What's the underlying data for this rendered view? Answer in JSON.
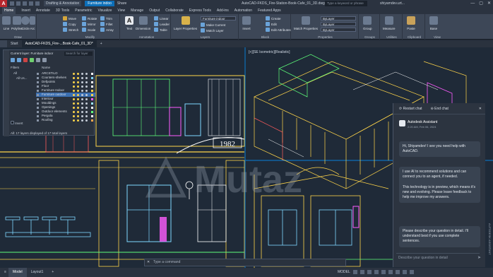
{
  "titlebar": {
    "logo": "A",
    "workspace": "Drafting & Annotation",
    "file_tab": "Furniture indoo",
    "share": "Share",
    "document_title": "AutoCAD-FKDS_Fire-Station-Book-Cafe_01_3D.dwg",
    "search_placeholder": "Type a keyword or phrase",
    "user": "shiyamdev.urt...",
    "min": "—",
    "max": "▢",
    "close": "✕"
  },
  "ribbon_tabs": [
    "Home",
    "Insert",
    "Annotate",
    "3D Tools",
    "Parametric",
    "Visualize",
    "View",
    "Manage",
    "Output",
    "Collaborate",
    "Express Tools",
    "Add-ins",
    "Automation",
    "Featured Apps"
  ],
  "ribbon": {
    "draw": {
      "title": "Draw",
      "buttons": [
        "Line",
        "Polyline",
        "Circle",
        "Arc"
      ]
    },
    "modify": {
      "title": "Modify",
      "buttons": [
        "Move",
        "Copy",
        "Stretch",
        "Rotate",
        "Mirror",
        "Scale",
        "Trim",
        "Fillet",
        "Array"
      ]
    },
    "annotation": {
      "title": "Annotation",
      "buttons": [
        "Text",
        "Dimension",
        "Linear",
        "Leader",
        "Table"
      ]
    },
    "layers": {
      "title": "Layers",
      "big": "Layer Properties",
      "current_layer": "Furniture indoor",
      "buttons": [
        "Make Current",
        "Match Layer"
      ]
    },
    "block": {
      "title": "Block",
      "buttons": [
        "Insert",
        "Create",
        "Edit",
        "Edit Attributes"
      ]
    },
    "properties": {
      "title": "Properties",
      "big": "Match Properties",
      "values": [
        "ByLayer",
        "ByLayer",
        "ByLayer"
      ]
    },
    "groups": {
      "title": "Groups",
      "big": "Group"
    },
    "utilities": {
      "title": "Utilities",
      "big": "Measure"
    },
    "clipboard": {
      "title": "Clipboard",
      "big": "Paste"
    },
    "view": {
      "title": "View",
      "big": "Base"
    }
  },
  "doc_tabs": [
    "Start",
    "AutoCAD-FKDS_Fire-...Book-Cafe_01_3D*",
    "+"
  ],
  "layer_palette": {
    "current_layer_label": "Current layer: Furniture indoor",
    "search_placeholder": "Search for layer",
    "filters_label": "Filters",
    "all_label": "All",
    "used_label": "All Us...",
    "name_header": "Name",
    "layers": [
      "ARCSTILO",
      "Counters-shelves",
      "Defpoints",
      "Floor",
      "Furniture Indoor",
      "Furniture outdoor",
      "Interiour",
      "Mouldings",
      "Openings",
      "Outdoor elements",
      "Pergola",
      "Roofing"
    ],
    "selected_index": 5,
    "invert_label": "Invert",
    "status": "All: 17 layers displayed of 17 total layers",
    "swatch_colors": [
      "#ffffff",
      "#7fd8ff",
      "#ffffff",
      "#ffffff",
      "#ffd54a",
      "#ffd54a",
      "#ff5cff",
      "#9fe8ff",
      "#ffffff",
      "#5fff7a",
      "#ffffff",
      "#ffa64d"
    ]
  },
  "viewport_label": "[+][SE Isometric][Realistic]",
  "date_label": "1982",
  "assistant": {
    "restart": "Restart chat",
    "end": "End chat",
    "name": "Autodesk Assistant",
    "time": "2:20 AM, Feb 06, 2024",
    "messages": [
      "Hi, Shiyamdev! I see you need help with AutoCAD.",
      "I use AI to recommend solutions and can connect you to an agent, if needed.\n\nThis technology is in preview, which means it's new and evolving. Please leave feedback to help me improve my answers.",
      "Please describe your question in detail. I'll understand best if you use complete sentences."
    ],
    "input_placeholder": "Describe your question in detail",
    "side_label": "AUTODESK ASSISTANT"
  },
  "command_line": {
    "placeholder": "Type a command"
  },
  "statusbar": {
    "tabs": [
      "Model",
      "Layout1",
      "+"
    ],
    "mode": "MODEL"
  },
  "watermark_text": "Mutaz",
  "colors": {
    "accent": "#0d6fb8",
    "selected_layer": "#3b6fb1",
    "autocad_red": "#b7272d"
  }
}
